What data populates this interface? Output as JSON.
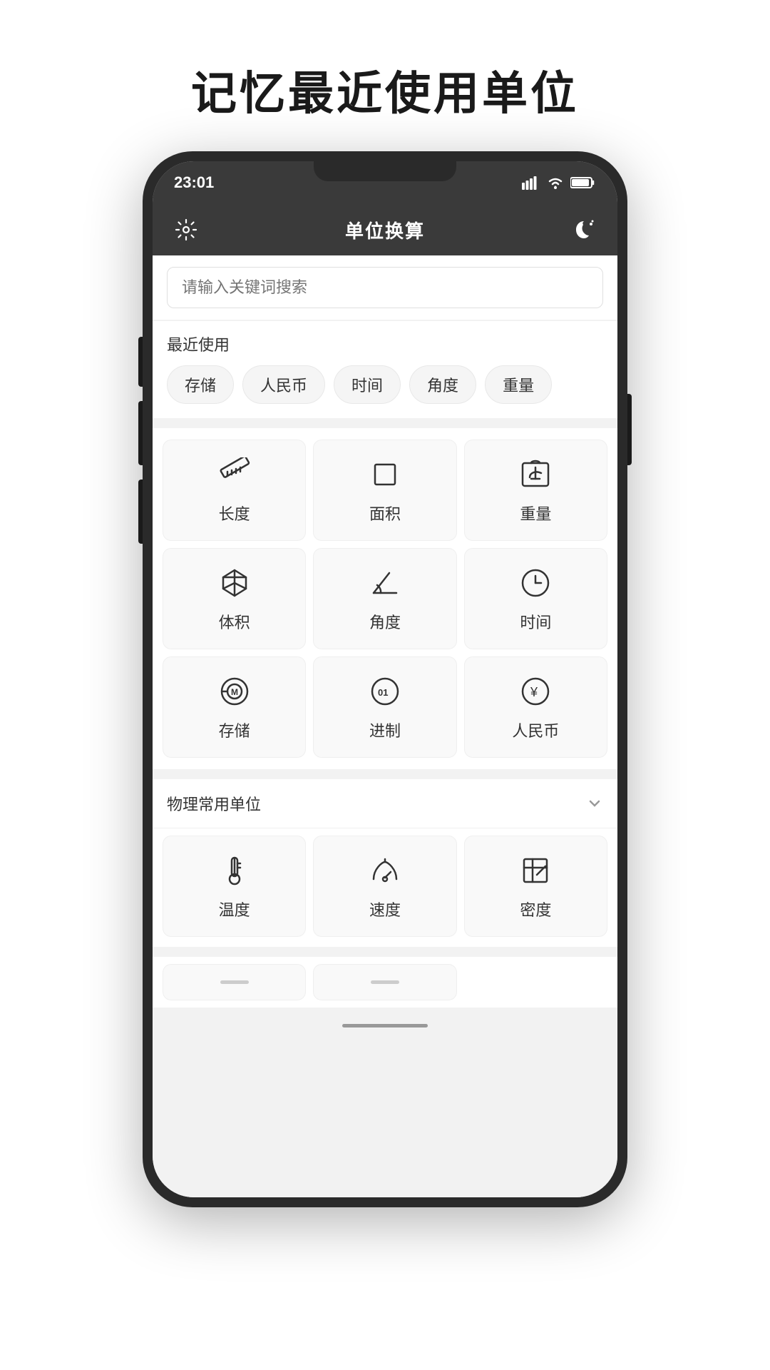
{
  "page": {
    "title": "记忆最近使用单位"
  },
  "status_bar": {
    "time": "23:01"
  },
  "header": {
    "title": "单位换算",
    "settings_icon": "⚙",
    "night_icon": "🌙"
  },
  "search": {
    "placeholder": "请输入关键词搜索"
  },
  "recent": {
    "label": "最近使用",
    "chips": [
      "存储",
      "人民币",
      "时间",
      "角度",
      "重量"
    ]
  },
  "main_grid": {
    "items": [
      {
        "id": "length",
        "label": "长度",
        "icon": "ruler"
      },
      {
        "id": "area",
        "label": "面积",
        "icon": "square"
      },
      {
        "id": "weight",
        "label": "重量",
        "icon": "scale"
      },
      {
        "id": "volume",
        "label": "体积",
        "icon": "box"
      },
      {
        "id": "angle",
        "label": "角度",
        "icon": "angle"
      },
      {
        "id": "time",
        "label": "时间",
        "icon": "clock"
      },
      {
        "id": "storage",
        "label": "存储",
        "icon": "storage"
      },
      {
        "id": "numbase",
        "label": "进制",
        "icon": "numbase"
      },
      {
        "id": "currency",
        "label": "人民币",
        "icon": "yuan"
      }
    ]
  },
  "physics_section": {
    "label": "物理常用单位",
    "items": [
      {
        "id": "temperature",
        "label": "温度",
        "icon": "thermometer"
      },
      {
        "id": "speed",
        "label": "速度",
        "icon": "speed"
      },
      {
        "id": "density",
        "label": "密度",
        "icon": "density"
      }
    ]
  },
  "colors": {
    "header_bg": "#3a3a3a",
    "body_bg": "#f2f2f2",
    "card_bg": "#f9f9f9",
    "text_primary": "#333333",
    "text_secondary": "#999999",
    "border": "#e8e8e8"
  }
}
